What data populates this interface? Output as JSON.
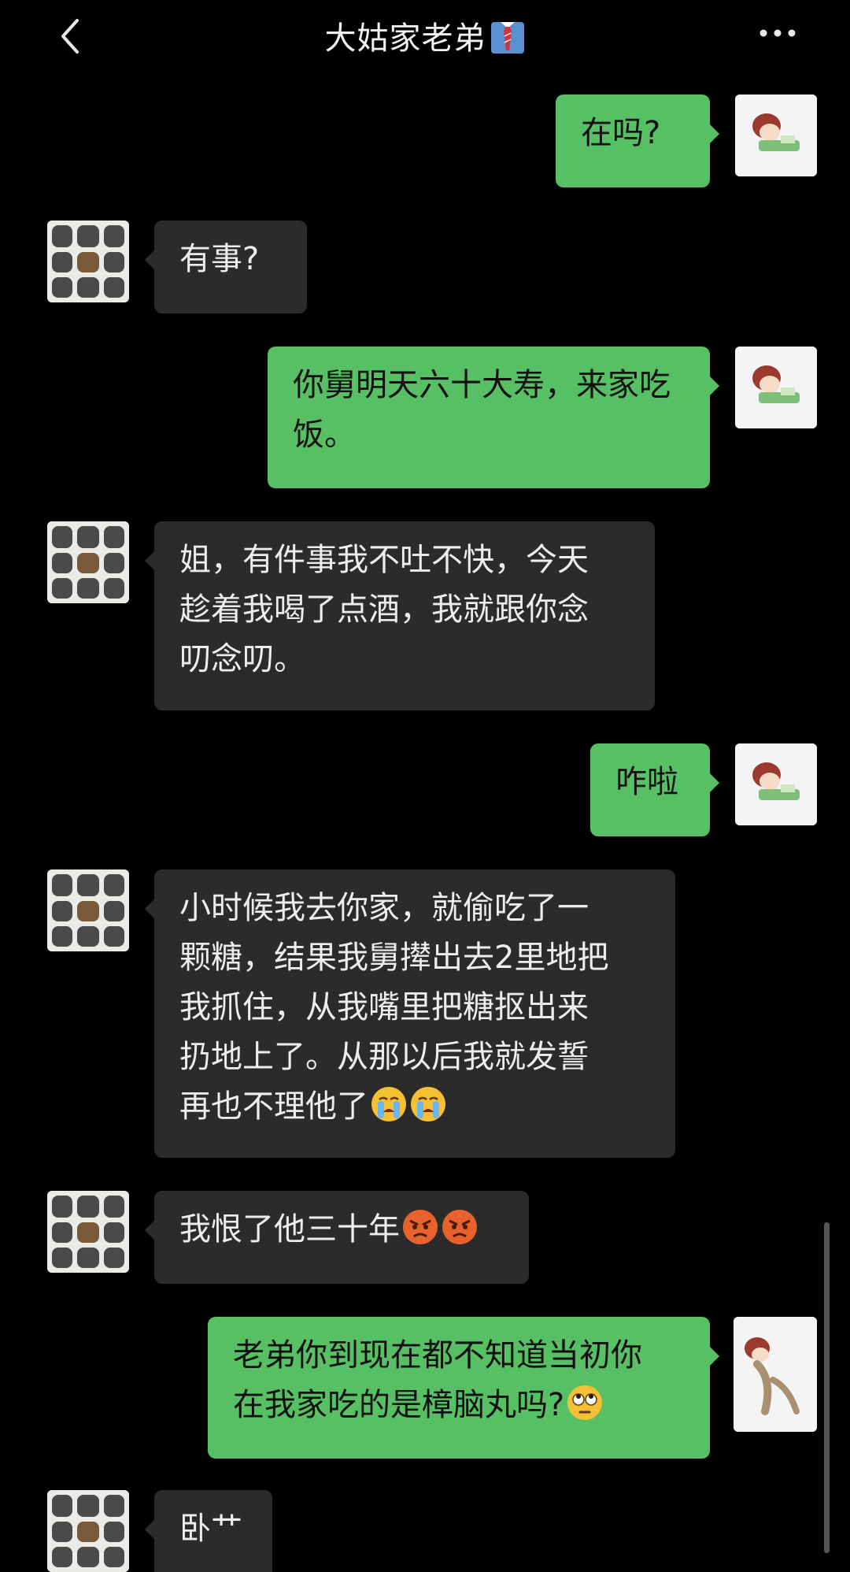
{
  "header": {
    "title": "大姑家老弟",
    "title_icon": "necktie-icon",
    "back_icon": "chevron-left-icon",
    "more_icon": "more-dots-icon"
  },
  "messages": [
    {
      "side": "out",
      "text": "在吗?"
    },
    {
      "side": "in",
      "text": "有事?"
    },
    {
      "side": "out",
      "text": "你舅明天六十大寿，来家吃\n饭。"
    },
    {
      "side": "in",
      "text": "姐，有件事我不吐不快，今天\n趁着我喝了点酒，我就跟你念\n叨念叨。"
    },
    {
      "side": "out",
      "text": "咋啦"
    },
    {
      "side": "in",
      "text": "小时候我去你家，就偷吃了一\n颗糖，结果我舅撵出去2里地把\n我抓住，从我嘴里把糖抠出来\n扔地上了。从那以后我就发誓\n再也不理他了",
      "emojis": [
        "crying-emoji",
        "crying-emoji"
      ]
    },
    {
      "side": "in",
      "text": "我恨了他三十年",
      "emojis": [
        "angry-emoji",
        "angry-emoji"
      ]
    },
    {
      "side": "out",
      "text": "老弟你到现在都不知道当初你\n在我家吃的是樟脑丸吗?",
      "emojis": [
        "rolling-eyes-emoji"
      ]
    },
    {
      "side": "in",
      "text": "卧艹"
    }
  ],
  "colors": {
    "background": "#000000",
    "incoming_bubble": "#2b2b2b",
    "outgoing_bubble": "#58c064"
  }
}
